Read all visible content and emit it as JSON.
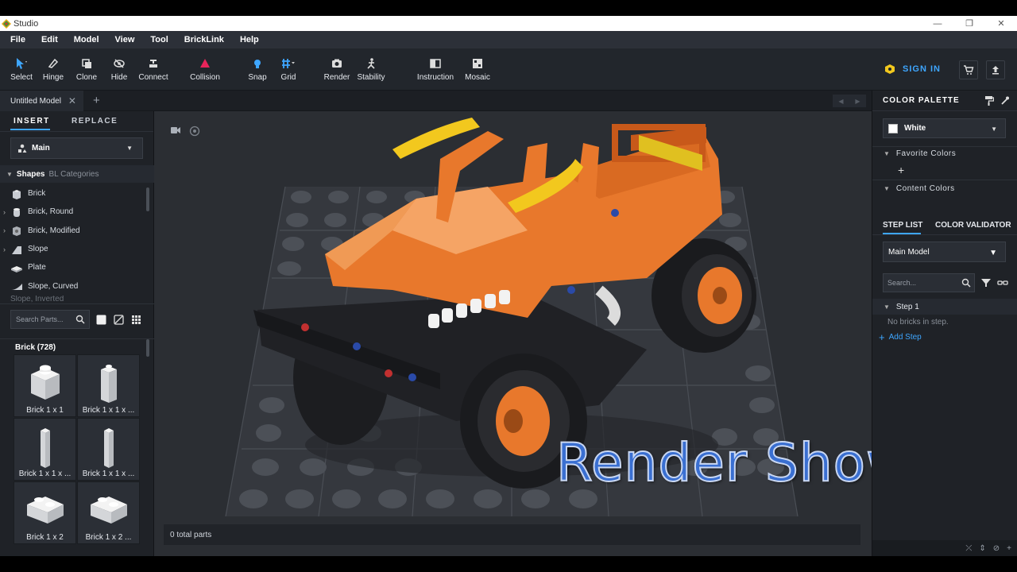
{
  "window": {
    "title": "Studio"
  },
  "menu": [
    "File",
    "Edit",
    "Model",
    "View",
    "Tool",
    "BrickLink",
    "Help"
  ],
  "toolbar": {
    "tools": [
      "Select",
      "Hinge",
      "Clone",
      "Hide",
      "Connect",
      "Collision",
      "Snap",
      "Grid",
      "Render",
      "Stability",
      "Instruction",
      "Mosaic"
    ],
    "sign_in": "SIGN IN",
    "accent": "#3ea6ff",
    "collision_color": "#e8245a"
  },
  "document": {
    "tab_label": "Untitled Model",
    "close_glyph": "✕",
    "add_glyph": "+"
  },
  "left_panel": {
    "tabs": [
      "INSERT",
      "REPLACE"
    ],
    "palette_select": "Main",
    "category_tabs": {
      "active": "Shapes",
      "inactive": "BL Categories"
    },
    "categories": [
      "Brick",
      "Brick, Round",
      "Brick, Modified",
      "Slope",
      "Plate",
      "Slope, Curved",
      "Slope, Inverted"
    ],
    "search_placeholder": "Search Parts...",
    "group_title": "Brick (728)",
    "parts": [
      "Brick 1 x 1",
      "Brick 1 x 1 x ...",
      "Brick 1 x 1 x ...",
      "Brick 1 x 1 x ...",
      "Brick 1 x 2",
      "Brick 1 x 2 ..."
    ]
  },
  "viewport": {
    "parts_count": "0 total parts",
    "overlay_title": "Render Show",
    "model_color": "#e8782c",
    "horn_color": "#f2c81e"
  },
  "right_panel": {
    "title": "COLOR PALETTE",
    "selected_color": "White",
    "sections": [
      "Favorite Colors",
      "Content Colors"
    ],
    "step_tabs": [
      "STEP LIST",
      "COLOR VALIDATOR"
    ],
    "model_select": "Main Model",
    "search_placeholder": "Search...",
    "step_label": "Step 1",
    "empty_text": "No bricks in step.",
    "add_step": "Add Step"
  }
}
